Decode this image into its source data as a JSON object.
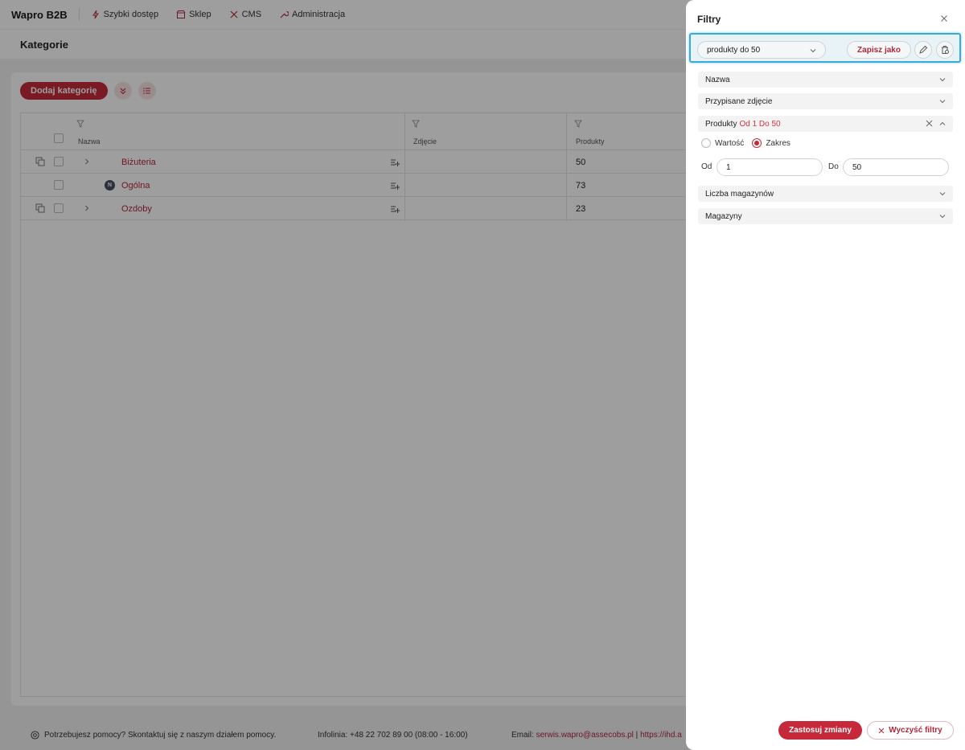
{
  "app": {
    "brand": "Wapro B2B",
    "nav": [
      {
        "label": "Szybki dostęp",
        "icon": "lightning-icon"
      },
      {
        "label": "Sklep",
        "icon": "shop-icon"
      },
      {
        "label": "CMS",
        "icon": "tools-icon"
      },
      {
        "label": "Administracja",
        "icon": "wrench-icon"
      }
    ]
  },
  "page": {
    "title": "Kategorie",
    "add_button": "Dodaj kategorię"
  },
  "table": {
    "columns": [
      "Nazwa",
      "Zdjęcie",
      "Produkty"
    ],
    "rows": [
      {
        "name": "Biżuteria",
        "products": "50",
        "expandable": true
      },
      {
        "name": "Ogólna",
        "products": "73",
        "badge": "N"
      },
      {
        "name": "Ozdoby",
        "products": "23",
        "expandable": true
      }
    ]
  },
  "footer": {
    "help": "Potrzebujesz pomocy? Skontaktuj się z naszym działem pomocy.",
    "phone": "Infolinia: +48 22 702 89 00 (08:00 - 16:00)",
    "email_label": "Email:",
    "email": "serwis.wapro@assecobs.pl",
    "separator": "|",
    "link": "https://ihd.a"
  },
  "filters": {
    "title": "Filtry",
    "preset": {
      "selected": "produkty do 50",
      "save_as": "Zapisz jako"
    },
    "sections": {
      "name": "Nazwa",
      "photo": "Przypisane zdjęcie",
      "products": "Produkty",
      "products_range": "Od 1 Do 50",
      "warehouse_count": "Liczba magazynów",
      "warehouses": "Magazyny"
    },
    "mode": {
      "value_label": "Wartość",
      "range_label": "Zakres",
      "selected": "Zakres"
    },
    "range": {
      "from_label": "Od",
      "from_value": "1",
      "to_label": "Do",
      "to_value": "50"
    },
    "apply": "Zastosuj zmiany",
    "clear": "Wyczyść filtry"
  },
  "colors": {
    "accent": "#c62a3a",
    "link": "#b3263a",
    "preset_highlight": "#3aaad8"
  }
}
